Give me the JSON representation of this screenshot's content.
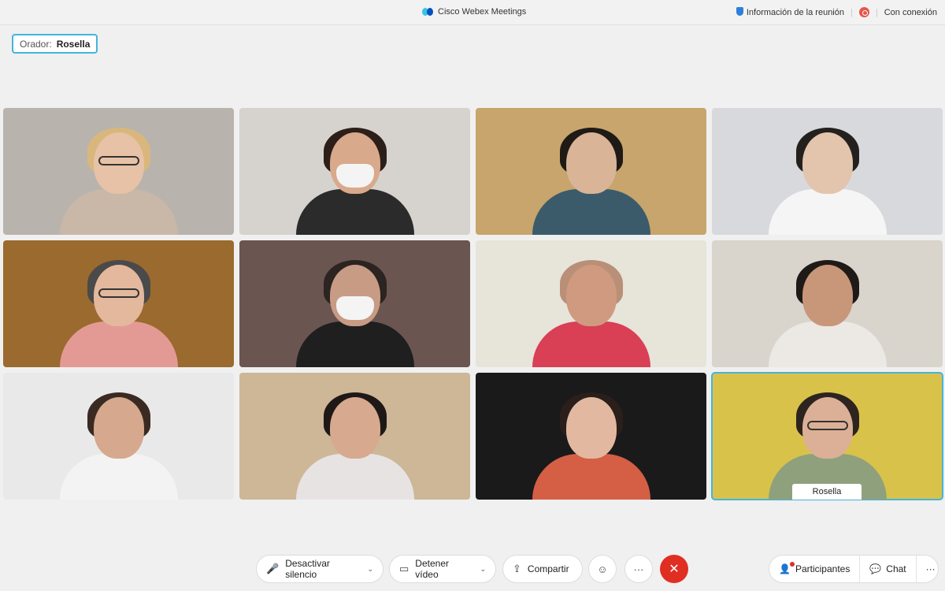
{
  "titlebar": {
    "app_title": "Cisco Webex Meetings",
    "meeting_info": "Información de la reunión",
    "connection": "Con conexión"
  },
  "speaker": {
    "label": "Orador:",
    "name": "Rosella"
  },
  "participants": [
    {
      "bg": "#b9b3ae",
      "skin": "#e7c2a6",
      "hair": "#d9b77c",
      "shirt": "#c9b7a8"
    },
    {
      "bg": "#d6d3cf",
      "skin": "#d8a98a",
      "hair": "#2c1f1a",
      "shirt": "#2b2b2b"
    },
    {
      "bg": "#c7a56c",
      "skin": "#d9b497",
      "hair": "#1f1a16",
      "shirt": "#3b5b6b"
    },
    {
      "bg": "#d7d9dc",
      "skin": "#e3c4ad",
      "hair": "#24201d",
      "shirt": "#f5f5f5"
    },
    {
      "bg": "#9a6a2e",
      "skin": "#e3b89c",
      "hair": "#4a4a4a",
      "shirt": "#e39a94"
    },
    {
      "bg": "#6b5550",
      "skin": "#c79b84",
      "hair": "#2b2420",
      "shirt": "#1f1f1f"
    },
    {
      "bg": "#e7e4da",
      "skin": "#cf9a80",
      "hair": "#b98f77",
      "shirt": "#d93f55"
    },
    {
      "bg": "#d9d4cc",
      "skin": "#c8977a",
      "hair": "#1f1a17",
      "shirt": "#ece8e4"
    },
    {
      "bg": "#e9e9e9",
      "skin": "#d6a88d",
      "hair": "#3a2a22",
      "shirt": "#f3f3f3"
    },
    {
      "bg": "#cdb797",
      "skin": "#d7a98f",
      "hair": "#1e1916",
      "shirt": "#e8e3e3"
    },
    {
      "bg": "#1a1a1a",
      "skin": "#e2b9a0",
      "hair": "#2a1f1a",
      "shirt": "#d45f45"
    },
    {
      "bg": "#d9c24a",
      "skin": "#dcb096",
      "hair": "#2d2420",
      "shirt": "#8fa17c"
    }
  ],
  "active_name": "Rosella",
  "toolbar": {
    "mute_label": "Desactivar silencio",
    "video_label": "Detener vídeo",
    "share_label": "Compartir",
    "participants_label": "Participantes",
    "chat_label": "Chat",
    "more": "···"
  }
}
